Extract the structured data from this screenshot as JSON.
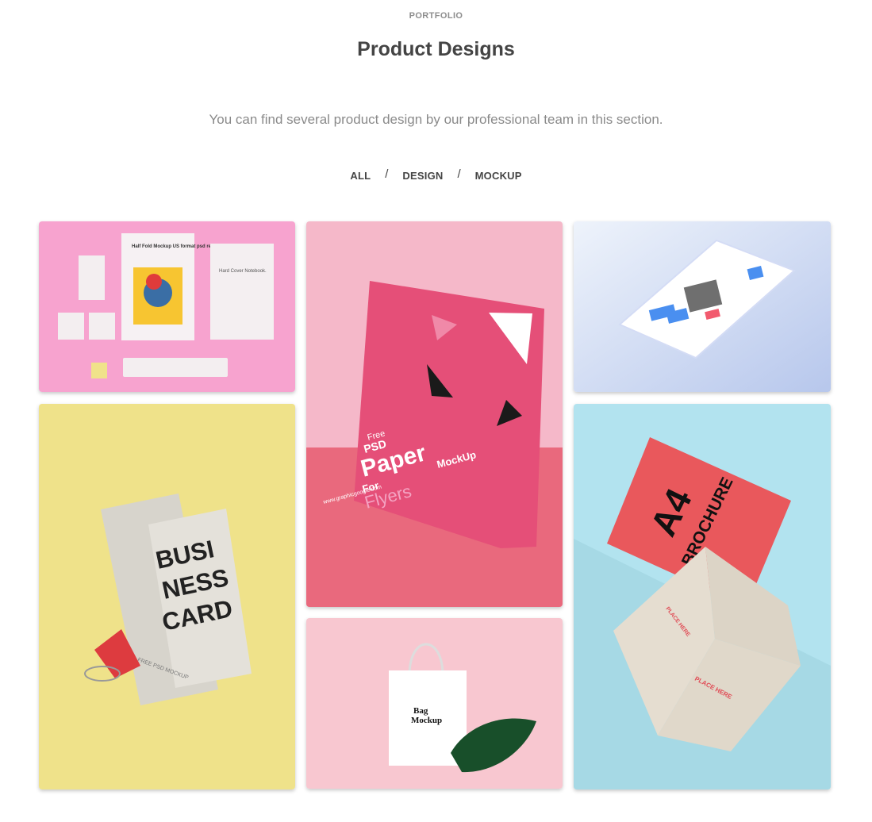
{
  "header": {
    "eyebrow": "PORTFOLIO",
    "title": "Product Designs",
    "subtitle": "You can find several product design by our professional team in this section."
  },
  "filters": [
    {
      "label": "ALL"
    },
    {
      "label": "DESIGN"
    },
    {
      "label": "MOCKUP"
    }
  ],
  "filter_separator": "/",
  "portfolio": {
    "item_1": {
      "bg_color": "#f7a3cf",
      "brochure_heading": "Half Fold Mockup US format psd resource Brochure Template.",
      "notebook_label": "Hard Cover Notebook."
    },
    "item_2": {
      "bg_color": "#f5b8c9",
      "text_free": "Free",
      "text_psd": "PSD",
      "text_paper": "Paper",
      "text_mockup": "MockUp",
      "text_for": "For",
      "text_flyers": "Flyers",
      "text_url": "www.graphicgoogle.com"
    },
    "item_3": {
      "bg_color": "#c9d7f2"
    },
    "item_4": {
      "bg_color": "#efe28a",
      "card_line_1": "BUSI",
      "card_line_2": "NESS",
      "card_line_3": "CARD",
      "card_footer": "FREE PSD MOCKUP"
    },
    "item_5": {
      "bg_color": "#f8c7d0",
      "bag_title_1": "Bag",
      "bag_title_2": "Mockup"
    },
    "item_6": {
      "bg_color": "#b2e3ef",
      "a4_text": "A4",
      "brochure_text": "BROCHURE",
      "place_here_1": "PLACE HERE",
      "place_here_2": "PLACE HERE"
    }
  }
}
